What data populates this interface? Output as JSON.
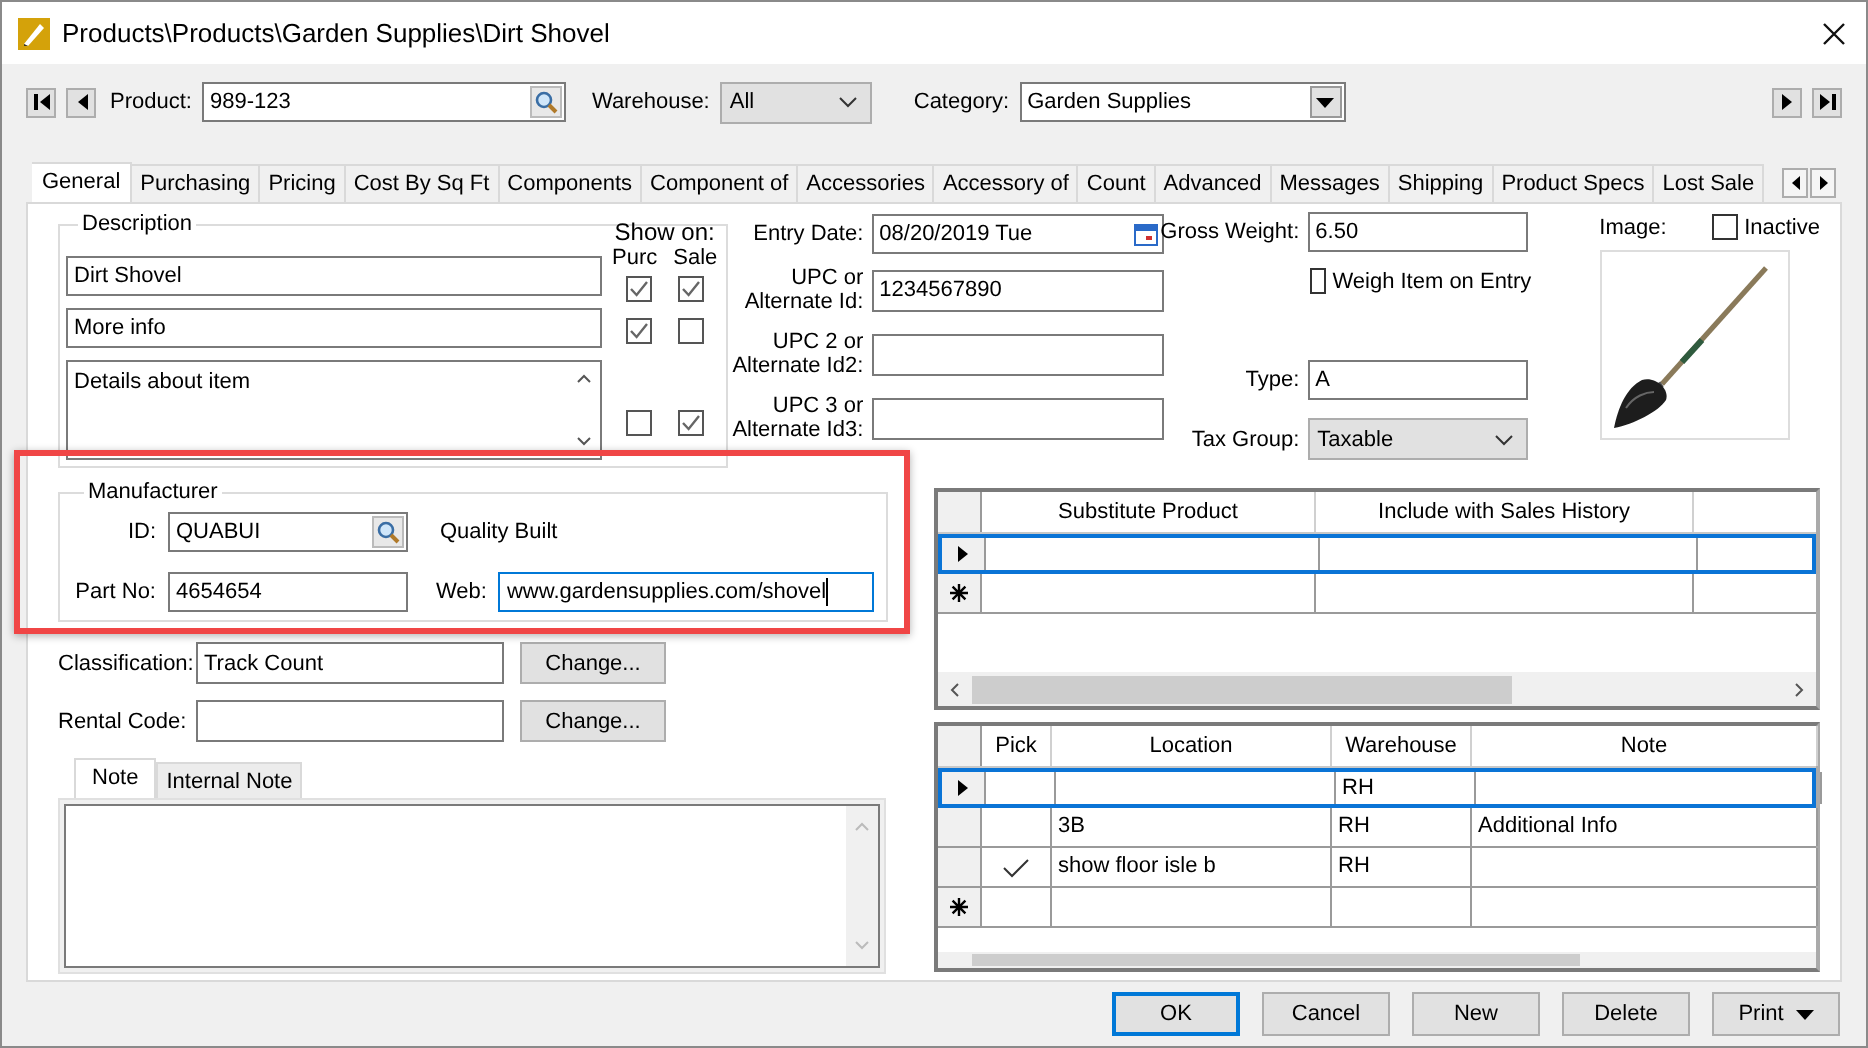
{
  "window": {
    "title": "Products\\Products\\Garden Supplies\\Dirt Shovel"
  },
  "toolbar": {
    "product_label": "Product:",
    "product": "989-123",
    "warehouse_label": "Warehouse:",
    "warehouse": "All",
    "category_label": "Category:",
    "category": "Garden Supplies"
  },
  "tabs": [
    {
      "label": "General",
      "selected": true
    },
    {
      "label": "Purchasing",
      "selected": false
    },
    {
      "label": "Pricing",
      "selected": false
    },
    {
      "label": "Cost By Sq Ft",
      "selected": false
    },
    {
      "label": "Components",
      "selected": false
    },
    {
      "label": "Component of",
      "selected": false
    },
    {
      "label": "Accessories",
      "selected": false
    },
    {
      "label": "Accessory of",
      "selected": false
    },
    {
      "label": "Count",
      "selected": false
    },
    {
      "label": "Advanced",
      "selected": false
    },
    {
      "label": "Messages",
      "selected": false
    },
    {
      "label": "Shipping",
      "selected": false
    },
    {
      "label": "Product Specs",
      "selected": false
    },
    {
      "label": "Lost Sale",
      "selected": false
    }
  ],
  "description": {
    "legend": "Description",
    "show_on_label": "Show on:",
    "columns": [
      "Purc",
      "Sale"
    ],
    "lines": [
      {
        "kind": "line",
        "value": "Dirt Shovel",
        "purc": true,
        "sale": true
      },
      {
        "kind": "line",
        "value": "More info",
        "purc": true,
        "sale": false
      },
      {
        "kind": "multiline",
        "value": "Details about item",
        "purc": false,
        "sale": true
      }
    ]
  },
  "ids": [
    {
      "kind": "date",
      "label": "Entry Date:",
      "value": "08/20/2019 Tue"
    },
    {
      "kind": "text",
      "label": "UPC or\nAlternate Id:",
      "value": "1234567890"
    },
    {
      "kind": "text",
      "label": "UPC 2 or\nAlternate Id2:"
    },
    {
      "kind": "text",
      "label": "UPC 3 or\nAlternate Id3:"
    }
  ],
  "gross_weight": {
    "label": "Gross Weight:",
    "value": "6.50"
  },
  "weigh_on_entry": {
    "label": "Weigh Item on Entry",
    "checked": false
  },
  "type": {
    "label": "Type:",
    "value": "A"
  },
  "tax_group": {
    "label": "Tax Group:",
    "value": "Taxable"
  },
  "image": {
    "label": "Image:",
    "kind": "picture"
  },
  "inactive": {
    "label": "Inactive",
    "checked": false
  },
  "manufacturer": {
    "legend": "Manufacturer",
    "id_label": "ID:",
    "id": "QUABUI",
    "name": "Quality Built",
    "part_label": "Part No:",
    "part": "4654654",
    "web_label": "Web:",
    "web": "www.gardensupplies.com/shovel"
  },
  "classification": {
    "label": "Classification:",
    "value": "Track Count",
    "button": "Change..."
  },
  "rental_code": {
    "label": "Rental Code:",
    "button": "Change..."
  },
  "note_tabs": [
    {
      "label": "Note",
      "selected": true
    },
    {
      "label": "Internal Note",
      "selected": false
    }
  ],
  "substitutes": {
    "columns": [
      "Substitute Product",
      "Include with Sales History"
    ],
    "rows": [
      {
        "kind": "current"
      },
      {
        "kind": "new"
      }
    ]
  },
  "locations": {
    "columns": [
      "Pick",
      "Location",
      "Warehouse",
      "Note"
    ],
    "rows": [
      {
        "kind": "current",
        "pick": false,
        "warehouse": "RH"
      },
      {
        "kind": "row",
        "pick": false,
        "location": "3B",
        "warehouse": "RH",
        "note": "Additional Info"
      },
      {
        "kind": "row",
        "pick": true,
        "location": "show floor isle b",
        "warehouse": "RH"
      },
      {
        "kind": "new",
        "pick": false
      }
    ]
  },
  "buttons": [
    {
      "label": "OK",
      "default": true,
      "kind": "plain"
    },
    {
      "label": "Cancel",
      "default": false,
      "kind": "plain"
    },
    {
      "label": "New",
      "default": false,
      "kind": "plain"
    },
    {
      "label": "Delete",
      "default": false,
      "kind": "plain"
    },
    {
      "label": "Print",
      "default": false,
      "kind": "menu"
    }
  ]
}
